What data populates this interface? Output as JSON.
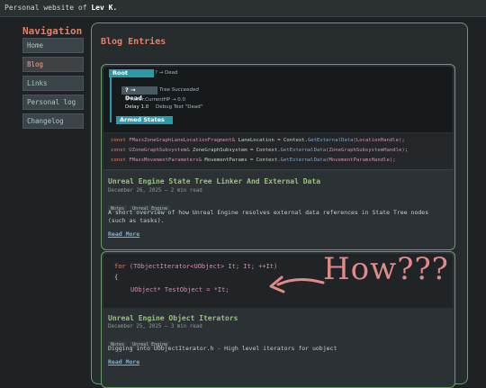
{
  "topbar": {
    "prefix": "Personal website of ",
    "name": "Lev K."
  },
  "nav": {
    "title": "Navigation",
    "items": [
      "Home",
      "Blog",
      "Links",
      "Personal log",
      "Changelog"
    ]
  },
  "main": {
    "title": "Blog Entries"
  },
  "posts": [
    {
      "graph": {
        "root_label": "Root",
        "root_arrow": "? → Dead",
        "dead_label": "? → Dead",
        "tree_succeeded": "Tree Succeeded",
        "cond1": "# Actor.CurrentHP → 0.0",
        "delay": "Delay 1.0",
        "debug_text": "Debug Text \"Dead\"",
        "armed_label": "Armed States"
      },
      "code_lines": [
        {
          "kw": "const ",
          "ty": "FMassZoneGraphLaneLocationFragment& ",
          "var": "LaneLocation = Context.",
          "fn": "GetExternalData",
          "arg": "(LocationHandle)",
          "end": ";"
        },
        {
          "kw": "const ",
          "ty": "UZoneGraphSubsystem& ",
          "var": "ZoneGraphSubsystem = Context.",
          "fn": "GetExternalData",
          "arg": "(ZoneGraphSubsystemHandle)",
          "end": ";"
        },
        {
          "kw": "const ",
          "ty": "FMassMovementParameters& ",
          "var": "MovementParams = Context.",
          "fn": "GetExternalData",
          "arg": "(MovementParamsHandle)",
          "end": ";"
        }
      ],
      "title": "Unreal Engine State Tree Linker And External Data",
      "meta": "December 26, 2025 – 2 min read",
      "tags": [
        "Notes",
        "Unreal Engine"
      ],
      "description": "A short overview of how Unreal Engine resolves external data references in State Tree nodes (such as tasks).",
      "read_more": "Read More"
    },
    {
      "code_line1_kw": "for ",
      "code_line1_rest": "(TObjectIterator<UObject> It; It; ++It)",
      "code_line2": "{",
      "code_line3": "UObject* TestObject = *It;",
      "handwriting": "How???",
      "title": "Unreal Engine Object Iterators",
      "meta": "December 25, 2025 – 3 min read",
      "tags": [
        "Notes",
        "Unreal Engine"
      ],
      "description": "Digging into UObjectIterator.h - High level iterators for uobject",
      "read_more": "Read More"
    }
  ]
}
